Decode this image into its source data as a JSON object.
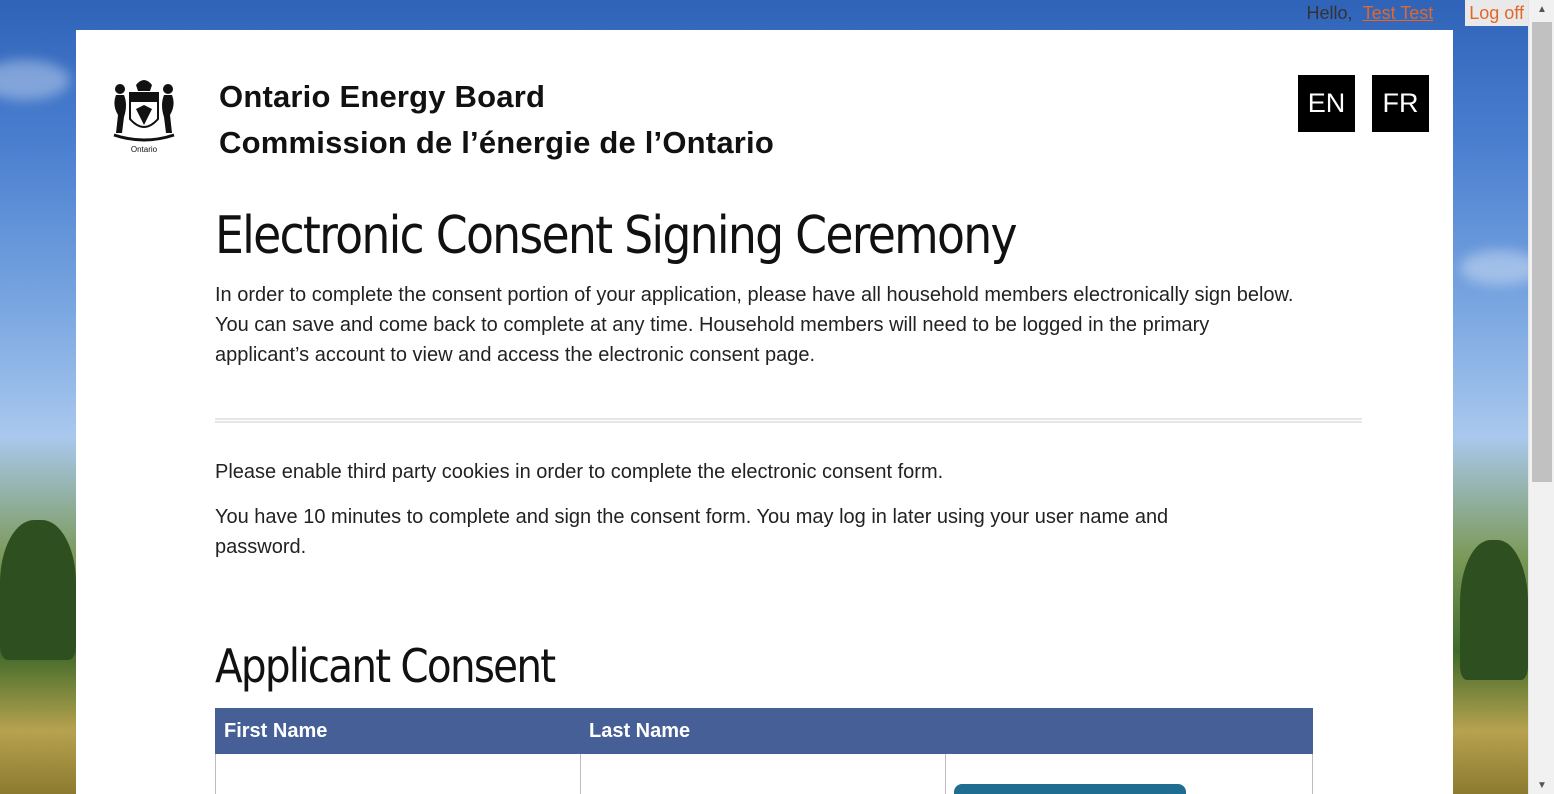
{
  "topbar": {
    "hello": "Hello,",
    "user_name": "Test Test",
    "logoff": "Log off"
  },
  "header": {
    "logo_caption": "Ontario",
    "org_name_en": "Ontario Energy Board",
    "org_name_fr": "Commission de l’énergie de l’Ontario",
    "lang_en": "EN",
    "lang_fr": "FR"
  },
  "main": {
    "title": "Electronic Consent Signing Ceremony",
    "intro": "In order to complete the consent portion of your application, please have all household members electronically sign below. You can save and come back to complete at any time. Household members will need to be logged in the primary applicant’s account to view and access the electronic consent page.",
    "cookies_notice": "Please enable third party cookies in order to complete the electronic consent form.",
    "timer_notice": "You have 10 minutes to complete and sign the consent form. You may log in later using your user name and password.",
    "section_title": "Applicant Consent"
  },
  "table": {
    "headers": [
      "First Name",
      "Last Name",
      ""
    ],
    "rows": [
      {
        "first_name": "",
        "last_name": ""
      }
    ]
  },
  "colors": {
    "link": "#e2672b",
    "table_header": "#466097",
    "sign_button": "#1f6e91"
  }
}
